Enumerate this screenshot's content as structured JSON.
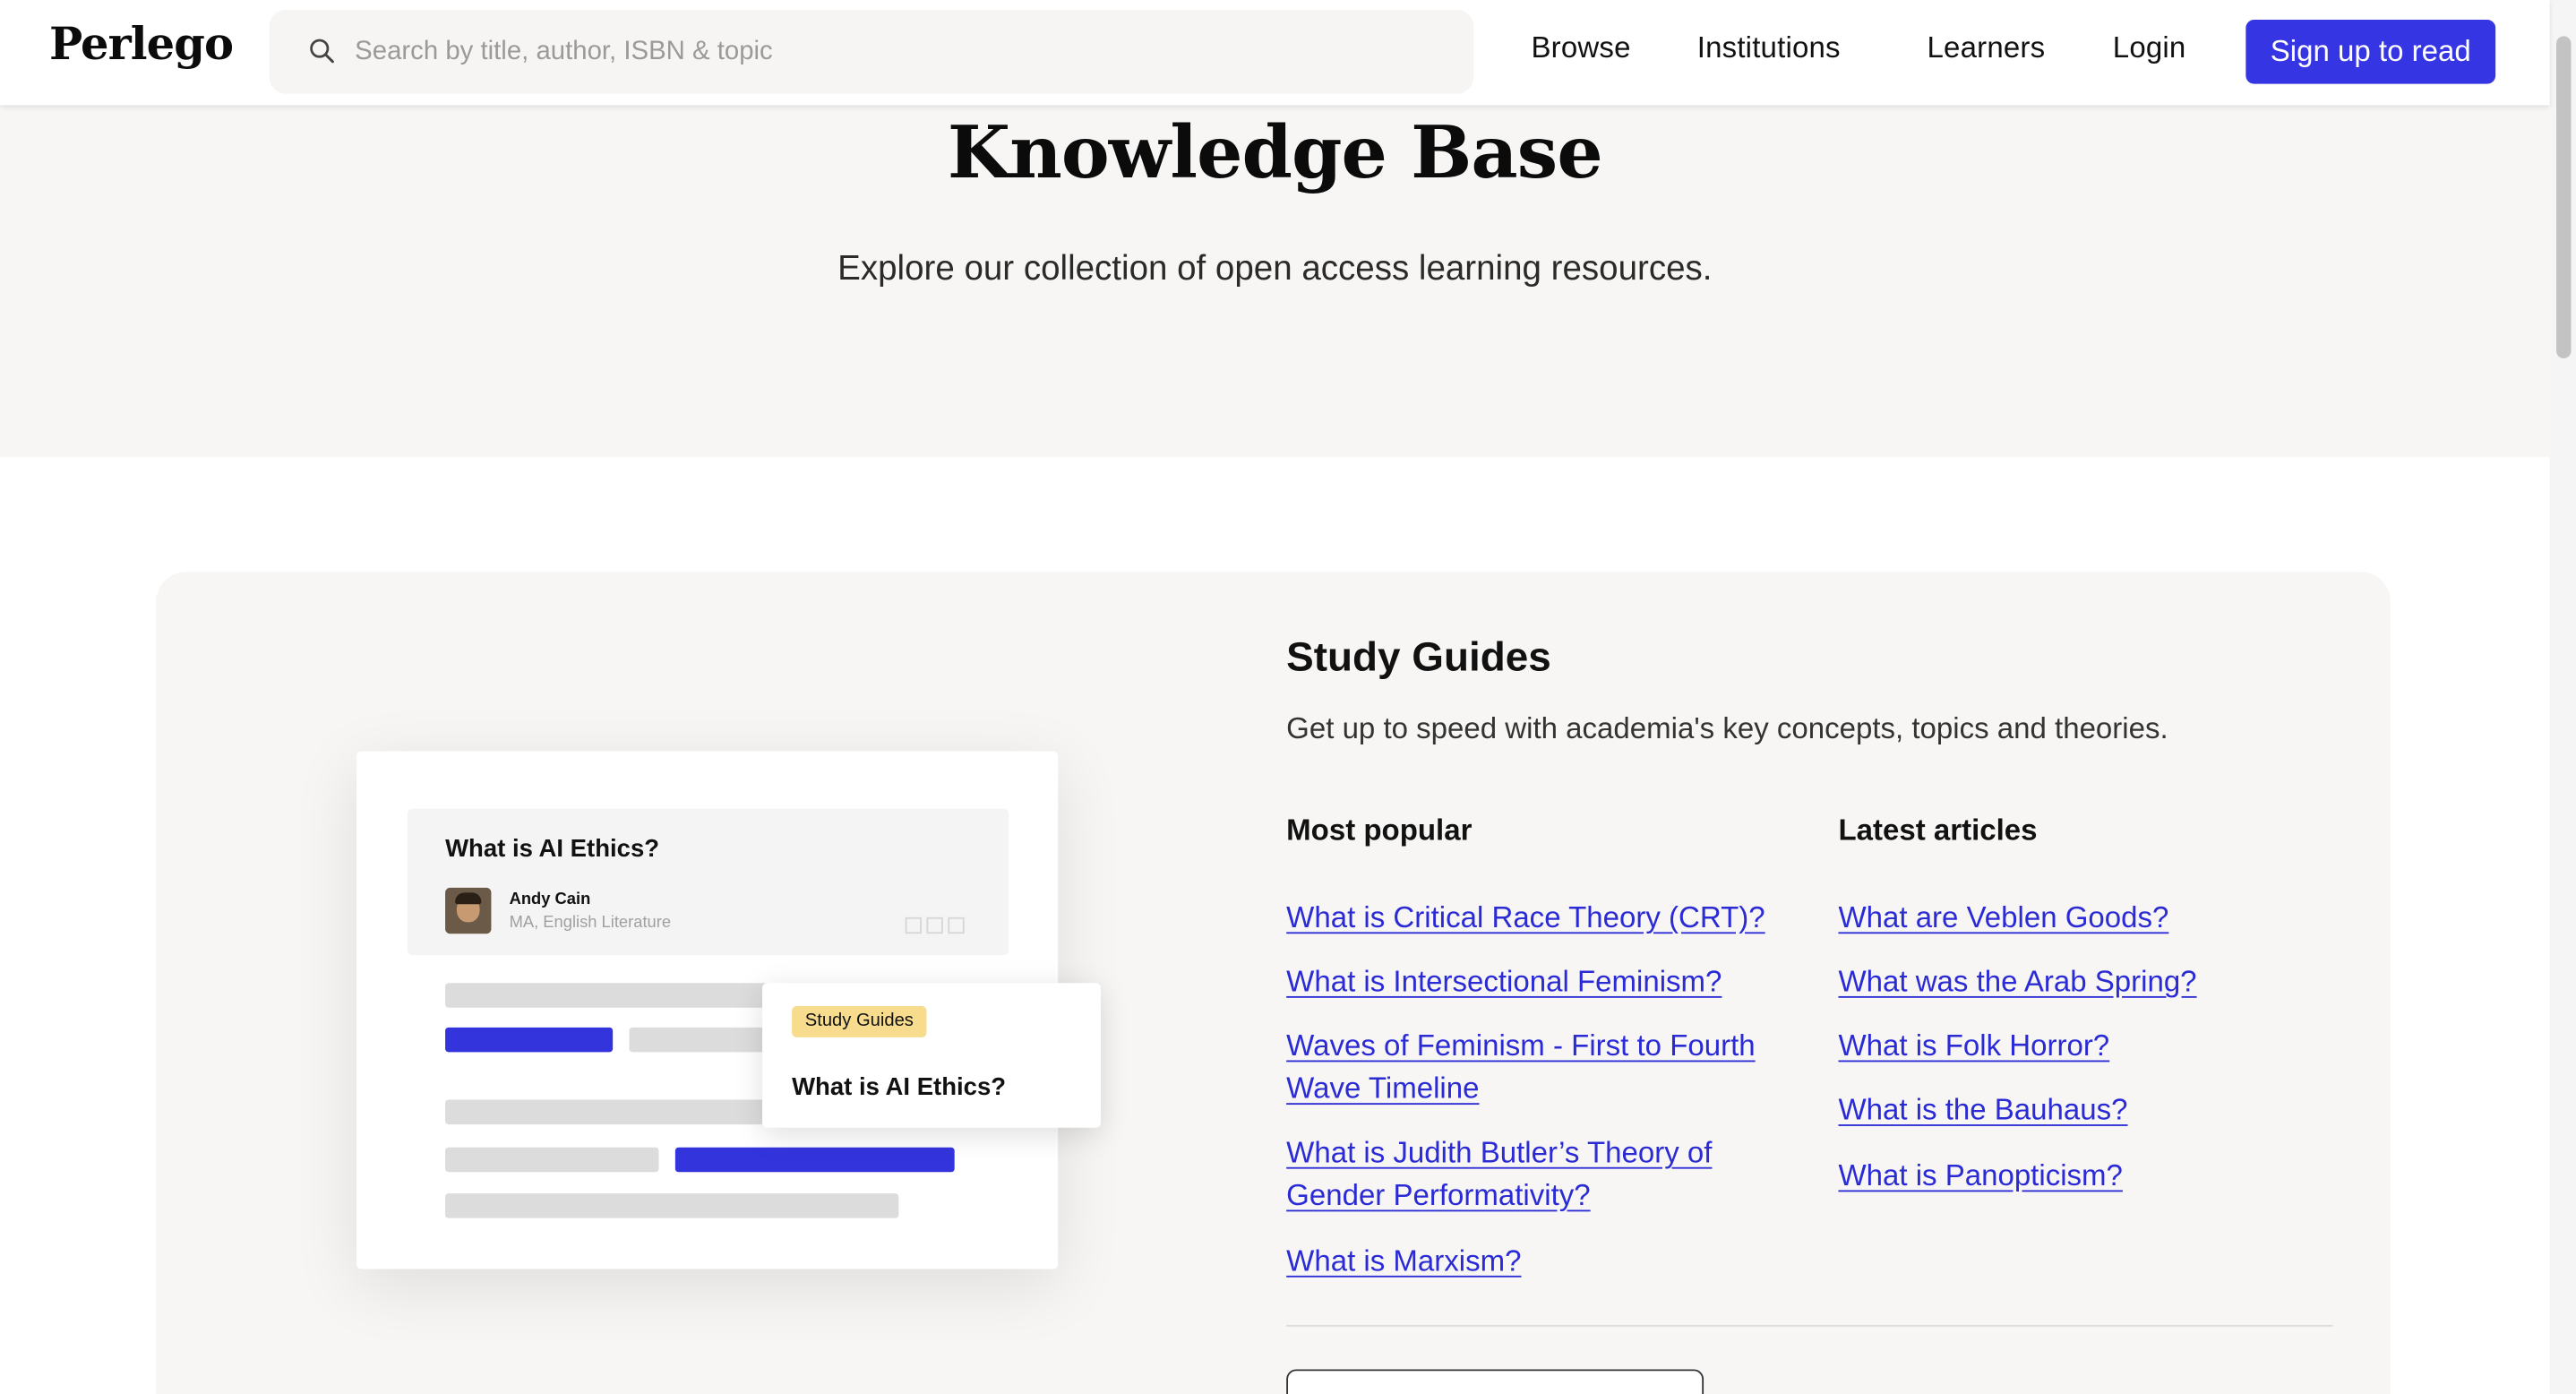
{
  "header": {
    "logo": "Perlego",
    "search_placeholder": "Search by title, author, ISBN & topic",
    "nav": [
      "Browse",
      "Institutions",
      "Learners",
      "Login"
    ],
    "cta": "Sign up to read"
  },
  "hero": {
    "title": "Knowledge Base",
    "subtitle": "Explore our collection of open access learning resources."
  },
  "illustration": {
    "title": "What is AI Ethics?",
    "author": "Andy Cain",
    "author_sub": "MA, English Literature",
    "popup_tag": "Study Guides",
    "popup_title": "What is AI Ethics?"
  },
  "section": {
    "title": "Study Guides",
    "subtitle": "Get up to speed with academia's key concepts, topics and theories.",
    "popular_heading": "Most popular",
    "latest_heading": "Latest articles",
    "popular": [
      "What is Critical Race Theory (CRT)?",
      "What is Intersectional Feminism?",
      "Waves of Feminism - First to Fourth Wave Timeline",
      "What is Judith Butler’s Theory of Gender Performativity?",
      "What is Marxism?"
    ],
    "latest": [
      "What are Veblen Goods?",
      "What was the Arab Spring?",
      "What is Folk Horror?",
      "What is the Bauhaus?",
      "What is Panopticism?"
    ]
  },
  "colors": {
    "accent": "#3535e3",
    "link": "#2b2bd6",
    "hero_bg": "#f7f6f4",
    "tag": "#f7dc8e"
  }
}
